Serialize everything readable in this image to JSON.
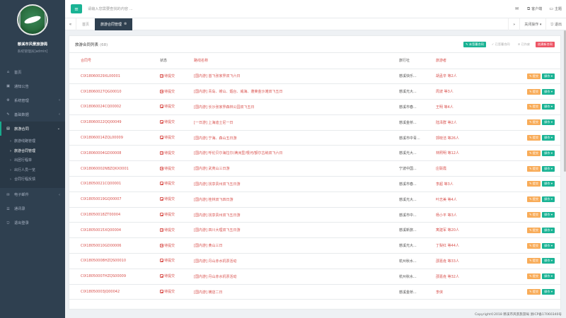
{
  "sidebar": {
    "org_name": "慈溪市风景旅游局",
    "user_label": "系统管理员[admin]",
    "items": [
      {
        "label": "首页",
        "icon": "home-icon",
        "glyph": "⌂"
      },
      {
        "label": "通知公告",
        "icon": "notice-icon",
        "glyph": "▣"
      },
      {
        "label": "系统管理",
        "icon": "gear-icon",
        "glyph": "⚙"
      },
      {
        "label": "基础数据",
        "icon": "edit-icon",
        "glyph": "✎"
      },
      {
        "label": "旅游合同",
        "icon": "contract-icon",
        "glyph": "▤"
      },
      {
        "label": "电子邮件",
        "icon": "mail-icon",
        "glyph": "✉"
      },
      {
        "label": "通讯录",
        "icon": "addressbook-icon",
        "glyph": "☰"
      },
      {
        "label": "退出登录",
        "icon": "logout-icon",
        "glyph": "⎋"
      }
    ],
    "sub_items": [
      "旅游线路管理",
      "旅游合同管理",
      "出团行程单",
      "出行人员一览",
      "合同行程反馈"
    ]
  },
  "topbar": {
    "menu_glyph": "≡",
    "search_placeholder": "请输入您需要查找的内容 ...",
    "mail_glyph": "✉",
    "client_label": "客户端",
    "theme_label": "主题"
  },
  "tabs": {
    "back": "«",
    "forward": "»",
    "home": "首页",
    "current": "旅游合同管理",
    "close_ops": "关闭操作",
    "exit": "退出"
  },
  "panel": {
    "title": "旅游合同列表",
    "count": "(68)",
    "actions": {
      "unsigned": "未签署合同",
      "signed": "已签署合同",
      "invalid": "已作废",
      "create": "创建新合同"
    }
  },
  "table": {
    "headers": [
      "合同号",
      "状态",
      "路线名称",
      "旅行社",
      "旅游者",
      ""
    ],
    "status_text": "待提交",
    "submit_label": "提交",
    "ops_label": "操作",
    "rows": [
      {
        "num": "CIX18060029XL00001",
        "route": "[国内游] 首飞张家界双飞六日",
        "agency": "慈溪快乐...",
        "tourist": "胡孟辛 等2人"
      },
      {
        "num": "CIX18060027QG00010",
        "route": "[国内游] 青岛、崂山、烟台、威海、蓬莱金沙滩双飞五日",
        "agency": "慈溪光大...",
        "tourist": "周波 等3人"
      },
      {
        "num": "CIX18060024CQ00002",
        "route": "[国内游] 长沙张家界森林公园双飞五日",
        "agency": "慈溪市春...",
        "tourist": "王明 等4人"
      },
      {
        "num": "CIX18060022QQ00049",
        "route": "[一日游] 上海迪士尼一日",
        "agency": "慈溪金桥...",
        "tourist": "陆泽群 等2人"
      },
      {
        "num": "CIX18060014ZQL00009",
        "route": "[国内游] 宁海、森山五日游",
        "agency": "慈溪市中青...",
        "tourist": "郭晓洁 等26人"
      },
      {
        "num": "CIX18060004GD00008",
        "route": "[国内游] 呼伦贝尔海拉尔/满洲里/根河/额尔古纳双飞六日",
        "agency": "慈溪光大...",
        "tourist": "林照明 等12人"
      },
      {
        "num": "CIX18060002NBZQKX0001",
        "route": "[国内游] 武夷山三日游",
        "agency": "宁波中国...",
        "tourist": "庄联霞"
      },
      {
        "num": "CIX18050021CQ00001",
        "route": "[国内游] 找享贵州双飞五日游",
        "agency": "慈溪市春...",
        "tourist": "李超 等3人"
      },
      {
        "num": "CIX18050019GQ00007",
        "route": "[国内游] 桂林双飞四日游",
        "agency": "慈溪光大...",
        "tourist": "叶志美 等4人"
      },
      {
        "num": "CIX18050018ZT00004",
        "route": "[国内游] 找享贵州双飞五日游",
        "agency": "慈溪市中...",
        "tourist": "杨小平 等3人"
      },
      {
        "num": "CIX18050015XQ00004",
        "route": "[国内游] 四川大理双飞五日游",
        "agency": "慈溪新旅...",
        "tourist": "寓建军 等20人"
      },
      {
        "num": "CIX18050010GD00006",
        "route": "[国内游] 黄山三日",
        "agency": "慈溪光大...",
        "tourist": "丁梨红 等44人"
      },
      {
        "num": "CIX18050008HZQS00010",
        "route": "[国内游] 丹山赤水机票活动",
        "agency": "杭州秋水...",
        "tourist": "邵嘉垚 等33人"
      },
      {
        "num": "CIX18050007HZQS00009",
        "route": "[国内游] 丹山赤水机票活动",
        "agency": "杭州秋水...",
        "tourist": "邵嘉垚 等32人"
      },
      {
        "num": "CIX18050003JQ00042",
        "route": "[国内游] 横店二日",
        "agency": "慈溪金桥...",
        "tourist": "李侠"
      }
    ]
  },
  "footer": "Copyright©2018 慈溪市风景旅游局 浙ICP备17060340号",
  "colors": {
    "sidebar": "#2f4050",
    "accent": "#1ab394",
    "danger": "#d9534f",
    "warning": "#f8ac59"
  }
}
